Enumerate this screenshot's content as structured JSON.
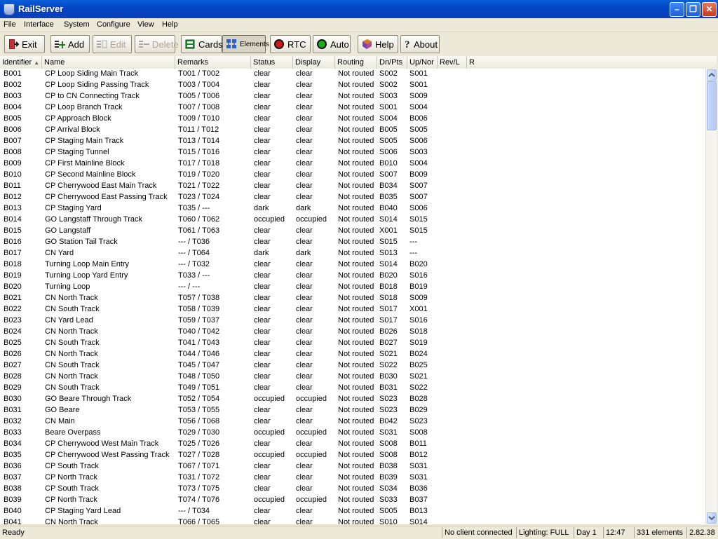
{
  "window": {
    "title": "RailServer"
  },
  "menu": [
    "File",
    "Interface",
    "System",
    "Configure",
    "View",
    "Help"
  ],
  "toolbar": {
    "exit": "Exit",
    "add": "Add",
    "edit": "Edit",
    "delete": "Delete",
    "cards": "Cards",
    "elements": "Elements",
    "rtc": "RTC",
    "auto": "Auto",
    "help": "Help",
    "about": "About"
  },
  "columns": [
    "Identifier",
    "Name",
    "Remarks",
    "Status",
    "Display",
    "Routing",
    "Dn/Pts",
    "Up/Nor",
    "Rev/L",
    "R"
  ],
  "rows": [
    [
      "B001",
      "CP Loop Siding Main Track",
      "T001 / T002",
      "clear",
      "clear",
      "Not routed",
      "S002",
      "S001"
    ],
    [
      "B002",
      "CP Loop Siding Passing Track",
      "T003 / T004",
      "clear",
      "clear",
      "Not routed",
      "S002",
      "S001"
    ],
    [
      "B003",
      "CP to CN Connecting Track",
      "T005 / T006",
      "clear",
      "clear",
      "Not routed",
      "S003",
      "S009"
    ],
    [
      "B004",
      "CP Loop Branch Track",
      "T007 / T008",
      "clear",
      "clear",
      "Not routed",
      "S001",
      "S004"
    ],
    [
      "B005",
      "CP Approach Block",
      "T009 / T010",
      "clear",
      "clear",
      "Not routed",
      "S004",
      "B006"
    ],
    [
      "B006",
      "CP Arrival Block",
      "T011 / T012",
      "clear",
      "clear",
      "Not routed",
      "B005",
      "S005"
    ],
    [
      "B007",
      "CP Staging Main Track",
      "T013 / T014",
      "clear",
      "clear",
      "Not routed",
      "S005",
      "S006"
    ],
    [
      "B008",
      "CP Staging Tunnel",
      "T015 / T016",
      "clear",
      "clear",
      "Not routed",
      "S006",
      "S003"
    ],
    [
      "B009",
      "CP First Mainline Block",
      "T017 / T018",
      "clear",
      "clear",
      "Not routed",
      "B010",
      "S004"
    ],
    [
      "B010",
      "CP Second Mainline Block",
      "T019 / T020",
      "clear",
      "clear",
      "Not routed",
      "S007",
      "B009"
    ],
    [
      "B011",
      "CP Cherrywood East Main Track",
      "T021 / T022",
      "clear",
      "clear",
      "Not routed",
      "B034",
      "S007"
    ],
    [
      "B012",
      "CP Cherrywood East Passing Track",
      "T023 / T024",
      "clear",
      "clear",
      "Not routed",
      "B035",
      "S007"
    ],
    [
      "B013",
      "CP Staging Yard",
      "T035 / ---",
      "dark",
      "dark",
      "Not routed",
      "B040",
      "S006"
    ],
    [
      "B014",
      "GO Langstaff Through Track",
      "T060 / T062",
      "occupied",
      "occupied",
      "Not routed",
      "S014",
      "S015"
    ],
    [
      "B015",
      "GO Langstaff",
      "T061 / T063",
      "clear",
      "clear",
      "Not routed",
      "X001",
      "S015"
    ],
    [
      "B016",
      "GO Station Tail Track",
      "--- / T036",
      "clear",
      "clear",
      "Not routed",
      "S015",
      "---"
    ],
    [
      "B017",
      "CN Yard",
      "--- / T064",
      "dark",
      "dark",
      "Not routed",
      "S013",
      "---"
    ],
    [
      "B018",
      "Turning Loop Main Entry",
      "--- / T032",
      "clear",
      "clear",
      "Not routed",
      "S014",
      "B020"
    ],
    [
      "B019",
      "Turning Loop Yard Entry",
      "T033 / ---",
      "clear",
      "clear",
      "Not routed",
      "B020",
      "S016"
    ],
    [
      "B020",
      "Turning Loop",
      "--- / ---",
      "clear",
      "clear",
      "Not routed",
      "B018",
      "B019"
    ],
    [
      "B021",
      "CN North Track",
      "T057 / T038",
      "clear",
      "clear",
      "Not routed",
      "S018",
      "S009"
    ],
    [
      "B022",
      "CN South Track",
      "T058 / T039",
      "clear",
      "clear",
      "Not routed",
      "S017",
      "X001"
    ],
    [
      "B023",
      "CN Yard Lead",
      "T059 / T037",
      "clear",
      "clear",
      "Not routed",
      "S017",
      "S016"
    ],
    [
      "B024",
      "CN North Track",
      "T040 / T042",
      "clear",
      "clear",
      "Not routed",
      "B026",
      "S018"
    ],
    [
      "B025",
      "CN South Track",
      "T041 / T043",
      "clear",
      "clear",
      "Not routed",
      "B027",
      "S019"
    ],
    [
      "B026",
      "CN North Track",
      "T044 / T046",
      "clear",
      "clear",
      "Not routed",
      "S021",
      "B024"
    ],
    [
      "B027",
      "CN South Track",
      "T045 / T047",
      "clear",
      "clear",
      "Not routed",
      "S022",
      "B025"
    ],
    [
      "B028",
      "CN North Track",
      "T048 / T050",
      "clear",
      "clear",
      "Not routed",
      "B030",
      "S021"
    ],
    [
      "B029",
      "CN South Track",
      "T049 / T051",
      "clear",
      "clear",
      "Not routed",
      "B031",
      "S022"
    ],
    [
      "B030",
      "GO Beare Through Track",
      "T052 / T054",
      "occupied",
      "occupied",
      "Not routed",
      "S023",
      "B028"
    ],
    [
      "B031",
      "GO Beare",
      "T053 / T055",
      "clear",
      "clear",
      "Not routed",
      "S023",
      "B029"
    ],
    [
      "B032",
      "CN Main",
      "T056 / T068",
      "clear",
      "clear",
      "Not routed",
      "B042",
      "S023"
    ],
    [
      "B033",
      "Beare Overpass",
      "T029 / T030",
      "occupied",
      "occupied",
      "Not routed",
      "S031",
      "S008"
    ],
    [
      "B034",
      "CP Cherrywood West Main Track",
      "T025 / T026",
      "clear",
      "clear",
      "Not routed",
      "S008",
      "B011"
    ],
    [
      "B035",
      "CP Cherrywood West Passing Track",
      "T027 / T028",
      "occupied",
      "occupied",
      "Not routed",
      "S008",
      "B012"
    ],
    [
      "B036",
      "CP South Track",
      "T067 / T071",
      "clear",
      "clear",
      "Not routed",
      "B038",
      "S031"
    ],
    [
      "B037",
      "CP North Track",
      "T031 / T072",
      "clear",
      "clear",
      "Not routed",
      "B039",
      "S031"
    ],
    [
      "B038",
      "CP South Track",
      "T073 / T075",
      "clear",
      "clear",
      "Not routed",
      "S034",
      "B036"
    ],
    [
      "B039",
      "CP North Track",
      "T074 / T076",
      "occupied",
      "occupied",
      "Not routed",
      "S033",
      "B037"
    ],
    [
      "B040",
      "CP Staging Yard Lead",
      "--- / T034",
      "clear",
      "clear",
      "Not routed",
      "S005",
      "B013"
    ],
    [
      "B041",
      "CN North Track",
      "T066 / T065",
      "clear",
      "clear",
      "Not routed",
      "S010",
      "S014"
    ]
  ],
  "status": {
    "left": "Ready",
    "client": "No client connected",
    "lighting": "Lighting: FULL",
    "day": "Day 1",
    "time": "12:47",
    "elements": "331 elements",
    "version": "2.82.38"
  }
}
